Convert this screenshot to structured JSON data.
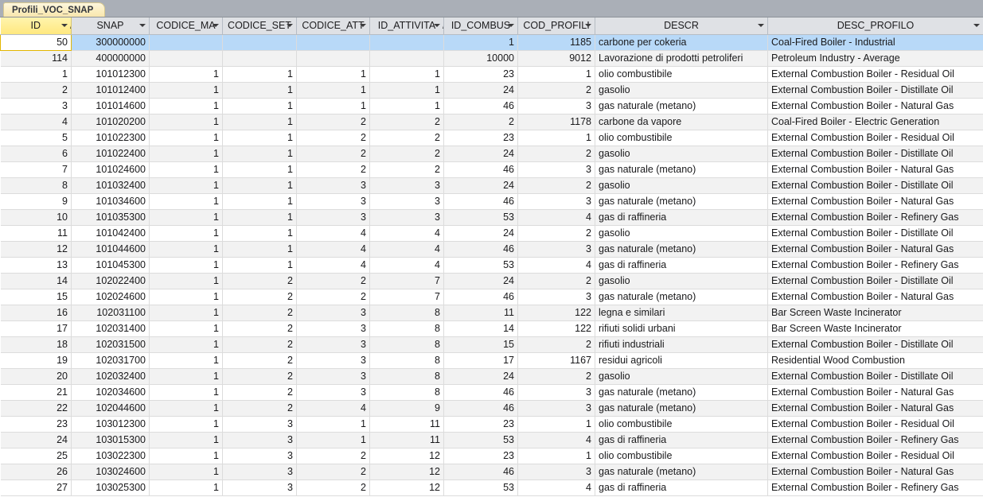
{
  "tab": {
    "label": "Profili_VOC_SNAP"
  },
  "colors": {
    "tab_strip": "#aaafb7",
    "header_bg": "#dfe1e5",
    "sorted_header_bg": "#ffe87f",
    "selected_row_bg": "#b8d9f8",
    "alt_row_bg": "#f2f2f2",
    "focus_border": "#e3b600"
  },
  "table": {
    "name": "Profili_VOC_SNAP",
    "columns": [
      {
        "key": "id",
        "label": "ID",
        "align": "num",
        "sorted": true,
        "sort": "asc",
        "filter_arrow": true
      },
      {
        "key": "snap",
        "label": "SNAP",
        "align": "num",
        "sorted": false,
        "filter_arrow": true
      },
      {
        "key": "codice_ma",
        "label": "CODICE_MA",
        "align": "num",
        "sorted": false,
        "filter_arrow": true
      },
      {
        "key": "codice_set",
        "label": "CODICE_SET",
        "align": "num",
        "sorted": false,
        "filter_arrow": true
      },
      {
        "key": "codice_att",
        "label": "CODICE_ATT",
        "align": "num",
        "sorted": false,
        "filter_arrow": true
      },
      {
        "key": "id_attivita",
        "label": "ID_ATTIVITA",
        "align": "num",
        "sorted": false,
        "sort": "asc",
        "filter_arrow": true
      },
      {
        "key": "id_combus",
        "label": "ID_COMBUS",
        "align": "num",
        "sorted": false,
        "filter_arrow": true
      },
      {
        "key": "cod_profili",
        "label": "COD_PROFILI",
        "align": "num",
        "sorted": false,
        "filter_arrow": true
      },
      {
        "key": "descr",
        "label": "DESCR",
        "align": "txt",
        "sorted": false,
        "filter_arrow": true
      },
      {
        "key": "desc_profilo",
        "label": "DESC_PROFILO",
        "align": "txt",
        "sorted": false,
        "filter_arrow": true
      }
    ],
    "rows": [
      {
        "selected": true,
        "id": "50",
        "snap": "300000000",
        "codice_ma": "",
        "codice_set": "",
        "codice_att": "",
        "id_attivita": "",
        "id_combus": "1",
        "cod_profili": "1185",
        "descr": "carbone per cokeria",
        "desc_profilo": "Coal-Fired Boiler - Industrial"
      },
      {
        "id": "114",
        "snap": "400000000",
        "codice_ma": "",
        "codice_set": "",
        "codice_att": "",
        "id_attivita": "",
        "id_combus": "10000",
        "cod_profili": "9012",
        "descr": "Lavorazione di prodotti petroliferi",
        "desc_profilo": "Petroleum Industry - Average"
      },
      {
        "id": "1",
        "snap": "101012300",
        "codice_ma": "1",
        "codice_set": "1",
        "codice_att": "1",
        "id_attivita": "1",
        "id_combus": "23",
        "cod_profili": "1",
        "descr": "olio combustibile",
        "desc_profilo": "External Combustion Boiler - Residual Oil"
      },
      {
        "id": "2",
        "snap": "101012400",
        "codice_ma": "1",
        "codice_set": "1",
        "codice_att": "1",
        "id_attivita": "1",
        "id_combus": "24",
        "cod_profili": "2",
        "descr": "gasolio",
        "desc_profilo": "External Combustion Boiler - Distillate Oil"
      },
      {
        "id": "3",
        "snap": "101014600",
        "codice_ma": "1",
        "codice_set": "1",
        "codice_att": "1",
        "id_attivita": "1",
        "id_combus": "46",
        "cod_profili": "3",
        "descr": "gas naturale (metano)",
        "desc_profilo": "External Combustion Boiler - Natural Gas"
      },
      {
        "id": "4",
        "snap": "101020200",
        "codice_ma": "1",
        "codice_set": "1",
        "codice_att": "2",
        "id_attivita": "2",
        "id_combus": "2",
        "cod_profili": "1178",
        "descr": "carbone da vapore",
        "desc_profilo": "Coal-Fired Boiler - Electric Generation"
      },
      {
        "id": "5",
        "snap": "101022300",
        "codice_ma": "1",
        "codice_set": "1",
        "codice_att": "2",
        "id_attivita": "2",
        "id_combus": "23",
        "cod_profili": "1",
        "descr": "olio combustibile",
        "desc_profilo": "External Combustion Boiler - Residual Oil"
      },
      {
        "id": "6",
        "snap": "101022400",
        "codice_ma": "1",
        "codice_set": "1",
        "codice_att": "2",
        "id_attivita": "2",
        "id_combus": "24",
        "cod_profili": "2",
        "descr": "gasolio",
        "desc_profilo": "External Combustion Boiler - Distillate Oil"
      },
      {
        "id": "7",
        "snap": "101024600",
        "codice_ma": "1",
        "codice_set": "1",
        "codice_att": "2",
        "id_attivita": "2",
        "id_combus": "46",
        "cod_profili": "3",
        "descr": "gas naturale (metano)",
        "desc_profilo": "External Combustion Boiler - Natural Gas"
      },
      {
        "id": "8",
        "snap": "101032400",
        "codice_ma": "1",
        "codice_set": "1",
        "codice_att": "3",
        "id_attivita": "3",
        "id_combus": "24",
        "cod_profili": "2",
        "descr": "gasolio",
        "desc_profilo": "External Combustion Boiler - Distillate Oil"
      },
      {
        "id": "9",
        "snap": "101034600",
        "codice_ma": "1",
        "codice_set": "1",
        "codice_att": "3",
        "id_attivita": "3",
        "id_combus": "46",
        "cod_profili": "3",
        "descr": "gas naturale (metano)",
        "desc_profilo": "External Combustion Boiler - Natural Gas"
      },
      {
        "id": "10",
        "snap": "101035300",
        "codice_ma": "1",
        "codice_set": "1",
        "codice_att": "3",
        "id_attivita": "3",
        "id_combus": "53",
        "cod_profili": "4",
        "descr": "gas di raffineria",
        "desc_profilo": "External Combustion Boiler - Refinery Gas"
      },
      {
        "id": "11",
        "snap": "101042400",
        "codice_ma": "1",
        "codice_set": "1",
        "codice_att": "4",
        "id_attivita": "4",
        "id_combus": "24",
        "cod_profili": "2",
        "descr": "gasolio",
        "desc_profilo": "External Combustion Boiler - Distillate Oil"
      },
      {
        "id": "12",
        "snap": "101044600",
        "codice_ma": "1",
        "codice_set": "1",
        "codice_att": "4",
        "id_attivita": "4",
        "id_combus": "46",
        "cod_profili": "3",
        "descr": "gas naturale (metano)",
        "desc_profilo": "External Combustion Boiler - Natural Gas"
      },
      {
        "id": "13",
        "snap": "101045300",
        "codice_ma": "1",
        "codice_set": "1",
        "codice_att": "4",
        "id_attivita": "4",
        "id_combus": "53",
        "cod_profili": "4",
        "descr": "gas di raffineria",
        "desc_profilo": "External Combustion Boiler - Refinery Gas"
      },
      {
        "id": "14",
        "snap": "102022400",
        "codice_ma": "1",
        "codice_set": "2",
        "codice_att": "2",
        "id_attivita": "7",
        "id_combus": "24",
        "cod_profili": "2",
        "descr": "gasolio",
        "desc_profilo": "External Combustion Boiler - Distillate Oil"
      },
      {
        "id": "15",
        "snap": "102024600",
        "codice_ma": "1",
        "codice_set": "2",
        "codice_att": "2",
        "id_attivita": "7",
        "id_combus": "46",
        "cod_profili": "3",
        "descr": "gas naturale (metano)",
        "desc_profilo": "External Combustion Boiler - Natural Gas"
      },
      {
        "id": "16",
        "snap": "102031100",
        "codice_ma": "1",
        "codice_set": "2",
        "codice_att": "3",
        "id_attivita": "8",
        "id_combus": "11",
        "cod_profili": "122",
        "descr": "legna e similari",
        "desc_profilo": "Bar Screen Waste Incinerator"
      },
      {
        "id": "17",
        "snap": "102031400",
        "codice_ma": "1",
        "codice_set": "2",
        "codice_att": "3",
        "id_attivita": "8",
        "id_combus": "14",
        "cod_profili": "122",
        "descr": "rifiuti solidi urbani",
        "desc_profilo": "Bar Screen Waste Incinerator"
      },
      {
        "id": "18",
        "snap": "102031500",
        "codice_ma": "1",
        "codice_set": "2",
        "codice_att": "3",
        "id_attivita": "8",
        "id_combus": "15",
        "cod_profili": "2",
        "descr": "rifiuti industriali",
        "desc_profilo": "External Combustion Boiler - Distillate Oil"
      },
      {
        "id": "19",
        "snap": "102031700",
        "codice_ma": "1",
        "codice_set": "2",
        "codice_att": "3",
        "id_attivita": "8",
        "id_combus": "17",
        "cod_profili": "1167",
        "descr": "residui agricoli",
        "desc_profilo": "Residential Wood Combustion"
      },
      {
        "id": "20",
        "snap": "102032400",
        "codice_ma": "1",
        "codice_set": "2",
        "codice_att": "3",
        "id_attivita": "8",
        "id_combus": "24",
        "cod_profili": "2",
        "descr": "gasolio",
        "desc_profilo": "External Combustion Boiler - Distillate Oil"
      },
      {
        "id": "21",
        "snap": "102034600",
        "codice_ma": "1",
        "codice_set": "2",
        "codice_att": "3",
        "id_attivita": "8",
        "id_combus": "46",
        "cod_profili": "3",
        "descr": "gas naturale (metano)",
        "desc_profilo": "External Combustion Boiler - Natural Gas"
      },
      {
        "id": "22",
        "snap": "102044600",
        "codice_ma": "1",
        "codice_set": "2",
        "codice_att": "4",
        "id_attivita": "9",
        "id_combus": "46",
        "cod_profili": "3",
        "descr": "gas naturale (metano)",
        "desc_profilo": "External Combustion Boiler - Natural Gas"
      },
      {
        "id": "23",
        "snap": "103012300",
        "codice_ma": "1",
        "codice_set": "3",
        "codice_att": "1",
        "id_attivita": "11",
        "id_combus": "23",
        "cod_profili": "1",
        "descr": "olio combustibile",
        "desc_profilo": "External Combustion Boiler - Residual Oil"
      },
      {
        "id": "24",
        "snap": "103015300",
        "codice_ma": "1",
        "codice_set": "3",
        "codice_att": "1",
        "id_attivita": "11",
        "id_combus": "53",
        "cod_profili": "4",
        "descr": "gas di raffineria",
        "desc_profilo": "External Combustion Boiler - Refinery Gas"
      },
      {
        "id": "25",
        "snap": "103022300",
        "codice_ma": "1",
        "codice_set": "3",
        "codice_att": "2",
        "id_attivita": "12",
        "id_combus": "23",
        "cod_profili": "1",
        "descr": "olio combustibile",
        "desc_profilo": "External Combustion Boiler - Residual Oil"
      },
      {
        "id": "26",
        "snap": "103024600",
        "codice_ma": "1",
        "codice_set": "3",
        "codice_att": "2",
        "id_attivita": "12",
        "id_combus": "46",
        "cod_profili": "3",
        "descr": "gas naturale (metano)",
        "desc_profilo": "External Combustion Boiler - Natural Gas"
      },
      {
        "id": "27",
        "snap": "103025300",
        "codice_ma": "1",
        "codice_set": "3",
        "codice_att": "2",
        "id_attivita": "12",
        "id_combus": "53",
        "cod_profili": "4",
        "descr": "gas di raffineria",
        "desc_profilo": "External Combustion Boiler - Refinery Gas"
      }
    ]
  }
}
